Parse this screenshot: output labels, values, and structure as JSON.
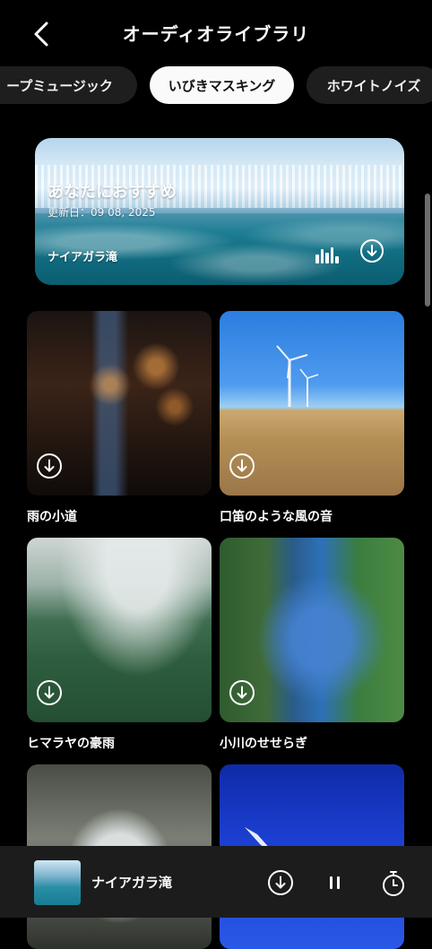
{
  "header": {
    "title": "オーディオライブラリ"
  },
  "tabs": [
    {
      "label": "ープミュージック",
      "active": false
    },
    {
      "label": "いびきマスキング",
      "active": true
    },
    {
      "label": "ホワイトノイズ",
      "active": false
    }
  ],
  "featured": {
    "heading": "あなたにおすすめ",
    "updated": "更新日：09 08, 2025",
    "name": "ナイアガラ滝"
  },
  "sounds": [
    {
      "label": "雨の小道"
    },
    {
      "label": "口笛のような風の音"
    },
    {
      "label": "ヒマラヤの豪雨"
    },
    {
      "label": "小川のせせらぎ"
    },
    {
      "label": ""
    },
    {
      "label": ""
    }
  ],
  "player": {
    "title": "ナイアガラ滝",
    "state": "playing"
  },
  "icons": {
    "back": "back-arrow-icon",
    "download": "download-icon",
    "equalizer": "equalizer-icon",
    "pause": "pause-icon",
    "timer": "timer-icon"
  }
}
